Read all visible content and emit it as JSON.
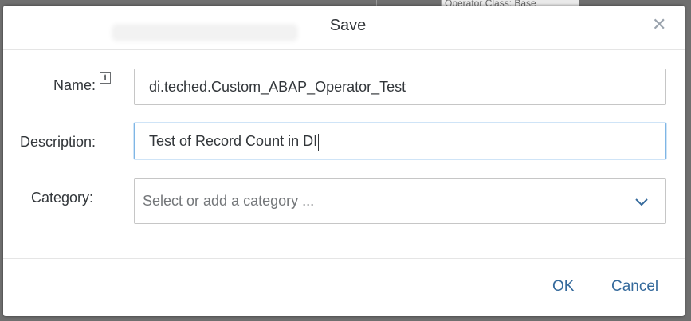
{
  "background": {
    "hint_text": "Operator Class: Base"
  },
  "dialog": {
    "title": "Save",
    "close_icon": "close-icon"
  },
  "form": {
    "name_label": "Name:",
    "name_info_glyph": "i",
    "name_value": "di.teched.Custom_ABAP_Operator_Test",
    "description_label": "Description:",
    "description_value": "Test of Record Count in DI",
    "category_label": "Category:",
    "category_placeholder": "Select or add a category ...",
    "category_icon": "chevron-down-icon"
  },
  "footer": {
    "ok_label": "OK",
    "cancel_label": "Cancel"
  },
  "colors": {
    "accent": "#356a9c",
    "focus_border": "#7fb6e5",
    "text": "#32363a"
  }
}
